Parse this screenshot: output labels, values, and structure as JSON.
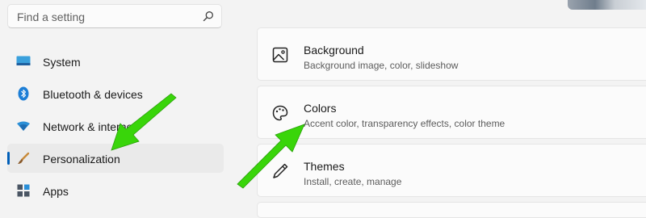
{
  "search": {
    "placeholder": "Find a setting",
    "icon": "search-icon"
  },
  "sidebar": {
    "items": [
      {
        "label": "System",
        "icon": "system-icon",
        "selected": false
      },
      {
        "label": "Bluetooth & devices",
        "icon": "bluetooth-icon",
        "selected": false
      },
      {
        "label": "Network & internet",
        "icon": "wifi-icon",
        "selected": false
      },
      {
        "label": "Personalization",
        "icon": "brush-icon",
        "selected": true
      },
      {
        "label": "Apps",
        "icon": "apps-icon",
        "selected": false
      }
    ]
  },
  "main": {
    "cards": [
      {
        "title": "Background",
        "subtitle": "Background image, color, slideshow",
        "icon": "picture-icon"
      },
      {
        "title": "Colors",
        "subtitle": "Accent color, transparency effects, color theme",
        "icon": "palette-icon"
      },
      {
        "title": "Themes",
        "subtitle": "Install, create, manage",
        "icon": "pen-icon"
      }
    ]
  },
  "colors": {
    "accent": "#005fb8",
    "annotation_arrow": "#39d50a"
  }
}
